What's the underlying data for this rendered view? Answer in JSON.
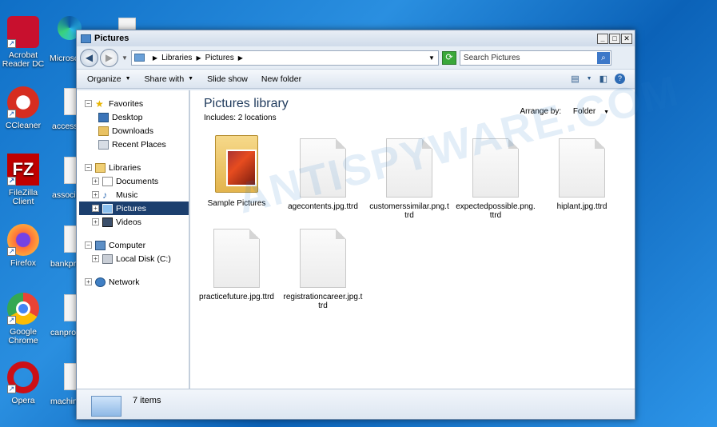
{
  "desktop": {
    "icons": [
      {
        "label": "Acrobat Reader DC",
        "color": "#c8102e"
      },
      {
        "label": "CCleaner",
        "color": "#d62d20"
      },
      {
        "label": "FileZilla Client",
        "color": "#bf0000"
      },
      {
        "label": "Firefox",
        "color": "#ff7139"
      },
      {
        "label": "Google Chrome",
        "color": "#4285f4"
      },
      {
        "label": "Opera",
        "color": "#cc0f16"
      }
    ],
    "partial_labels": [
      "Microso",
      "accessc",
      "associa",
      "bankpro",
      "canpro",
      "machin"
    ]
  },
  "window": {
    "title": "Pictures",
    "address": {
      "parts": [
        "Libraries",
        "Pictures"
      ]
    },
    "search_placeholder": "Search Pictures",
    "toolbar": {
      "organize": "Organize",
      "share_with": "Share with",
      "slide_show": "Slide show",
      "new_folder": "New folder"
    },
    "nav": {
      "favorites": {
        "label": "Favorites",
        "items": [
          "Desktop",
          "Downloads",
          "Recent Places"
        ]
      },
      "libraries": {
        "label": "Libraries",
        "items": [
          "Documents",
          "Music",
          "Pictures",
          "Videos"
        ]
      },
      "computer": {
        "label": "Computer",
        "items": [
          "Local Disk (C:)"
        ]
      },
      "network": {
        "label": "Network"
      }
    },
    "content": {
      "title": "Pictures library",
      "subtitle": "Includes:  2 locations",
      "arrange_label": "Arrange by:",
      "arrange_value": "Folder",
      "items": [
        {
          "name": "Sample Pictures",
          "type": "folder"
        },
        {
          "name": "agecontents.jpg.ttrd",
          "type": "file"
        },
        {
          "name": "customerssimilar.png.ttrd",
          "type": "file"
        },
        {
          "name": "expectedpossible.png.ttrd",
          "type": "file"
        },
        {
          "name": "hiplant.jpg.ttrd",
          "type": "file"
        },
        {
          "name": "practicefuture.jpg.ttrd",
          "type": "file"
        },
        {
          "name": "registrationcareer.jpg.ttrd",
          "type": "file"
        }
      ]
    },
    "status": {
      "count": "7 items"
    }
  },
  "watermark": "ANTISPYWARE.COM"
}
